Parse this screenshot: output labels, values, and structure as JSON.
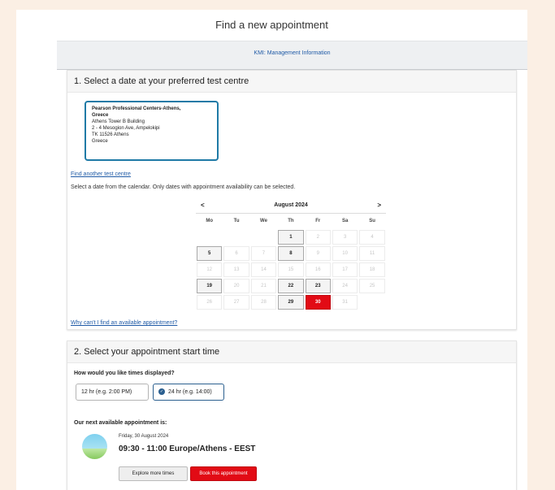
{
  "page": {
    "title": "Find a new appointment",
    "band_link": "KMI: Management Information"
  },
  "step1": {
    "title": "1. Select a date at your preferred test centre",
    "centre": {
      "name_line1": "Pearson Professional Centers-Athens,",
      "name_line2": "Greece",
      "address1": "Athens Tower B Building",
      "address2": "2 - 4 Mesogion Ave, Ampelokipi",
      "address3": "TK 11526 Athens",
      "country": "Greece"
    },
    "find_another_link": "Find another test centre",
    "instruction": "Select a date from the calendar. Only dates with appointment availability can be selected.",
    "calendar": {
      "prev": "<",
      "next": ">",
      "month": "August 2024",
      "weekdays": [
        "Mo",
        "Tu",
        "We",
        "Th",
        "Fr",
        "Sa",
        "Su"
      ],
      "weeks": [
        [
          "",
          "",
          "",
          "1",
          "2",
          "3",
          "4"
        ],
        [
          "5",
          "6",
          "7",
          "8",
          "9",
          "10",
          "11"
        ],
        [
          "12",
          "13",
          "14",
          "15",
          "16",
          "17",
          "18"
        ],
        [
          "19",
          "20",
          "21",
          "22",
          "23",
          "24",
          "25"
        ],
        [
          "26",
          "27",
          "28",
          "29",
          "30",
          "31",
          ""
        ]
      ],
      "available_days": [
        "1",
        "5",
        "8",
        "19",
        "22",
        "23",
        "29",
        "30"
      ],
      "selected_day": "30"
    },
    "why_link": "Why can't I find an available appointment?"
  },
  "step2": {
    "title": "2. Select your appointment start time",
    "question": "How would you like times displayed?",
    "option_12": "12 hr (e.g. 2:00 PM)",
    "option_24": "24 hr (e.g. 14:00)",
    "selected_option": "24",
    "next_label": "Our next available appointment is:",
    "next_date": "Friday, 30 August 2024",
    "next_time": "09:30 - 11:00 Europe/Athens - EEST",
    "explore_button": "Explore more times",
    "book_button": "Book this appointment"
  },
  "colors": {
    "accent_red": "#e20b15",
    "link_blue": "#1f5aa6",
    "centre_border": "#1f7aa6",
    "background": "#fbefe4"
  },
  "icons": {
    "check": "check-circle-icon",
    "availability": "landscape-icon"
  }
}
